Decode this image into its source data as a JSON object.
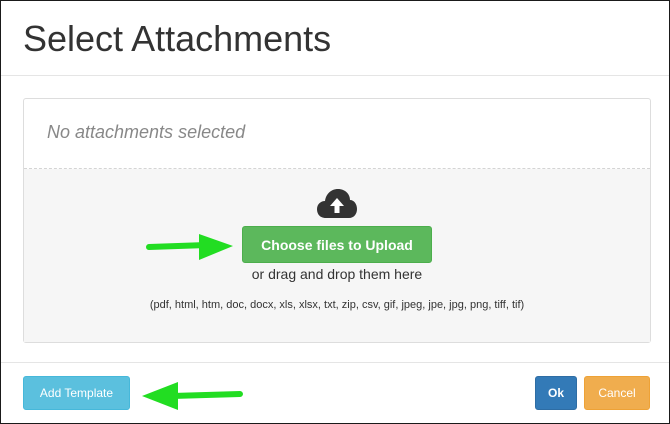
{
  "dialog": {
    "title": "Select Attachments"
  },
  "attachments": {
    "empty_text": "No attachments selected"
  },
  "dropzone": {
    "icon": "cloud-upload-icon",
    "upload_button_label": "Choose files to Upload",
    "drag_text": "or drag and drop them here",
    "file_types": "(pdf, html, htm, doc, docx, xls, xlsx, txt, zip, csv, gif, jpeg, jpe, jpg, png, tiff, tif)"
  },
  "footer": {
    "add_template_label": "Add Template",
    "ok_label": "Ok",
    "cancel_label": "Cancel"
  },
  "annotations": {
    "arrow_icon": "arrow-right-icon",
    "arrow_color": "#22dd22"
  },
  "colors": {
    "upload_green": "#5cb85c",
    "info_blue": "#5bc0de",
    "primary_blue": "#337ab7",
    "warning_orange": "#f0ad4e"
  }
}
